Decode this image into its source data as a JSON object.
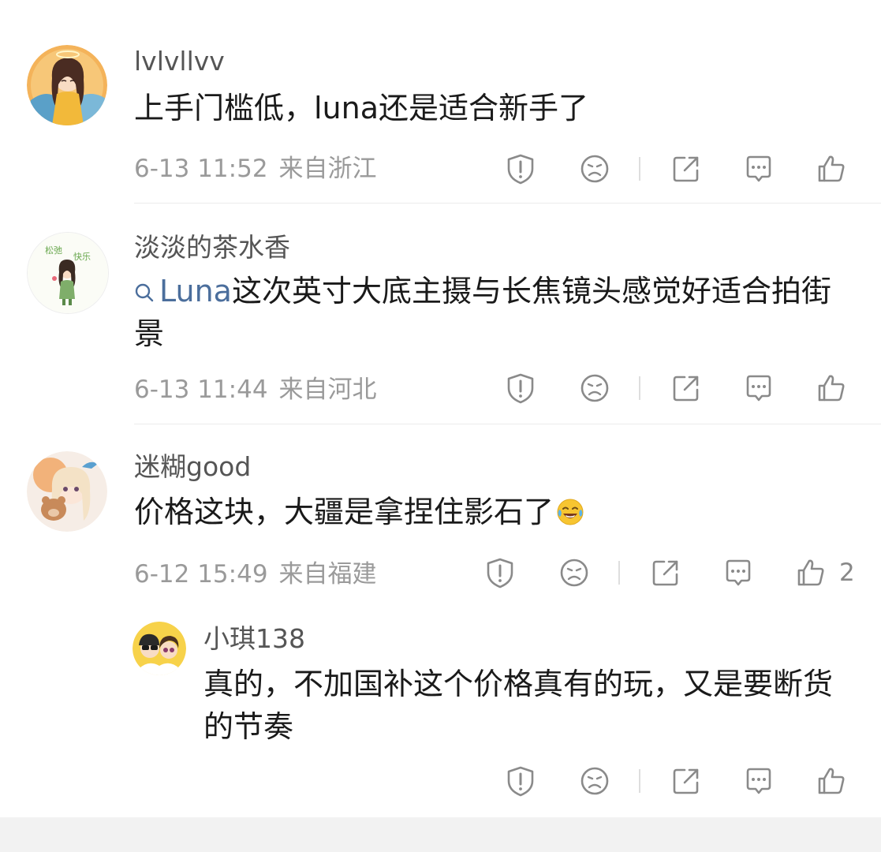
{
  "comments": [
    {
      "username": "lvlvllvv",
      "content": "上手门槛低，luna还是适合新手了",
      "time": "6-13 11:52",
      "location": "来自浙江"
    },
    {
      "username": "淡淡的茶水香",
      "topic": "Luna",
      "content": "这次英寸大底主摄与长焦镜头感觉好适合拍街景",
      "time": "6-13 11:44",
      "location": "来自河北"
    },
    {
      "username": "迷糊good",
      "content": "价格这块，大疆是拿捏住影石了",
      "emoji": "laugh-cry-emoji",
      "time": "6-12 15:49",
      "location": "来自福建",
      "like_count": "2"
    }
  ],
  "reply": {
    "username": "小琪138",
    "content": "真的，不加国补这个价格真有的玩，又是要断货的节奏"
  },
  "icons": {
    "report": "shield-alert-icon",
    "dislike": "frown-face-icon",
    "share": "share-icon",
    "comment": "comment-icon",
    "like": "thumbs-up-icon"
  },
  "colors": {
    "topic_link": "#4b6e9c",
    "meta_text": "#9a9a9a",
    "icon_stroke": "#8a8a8a"
  }
}
